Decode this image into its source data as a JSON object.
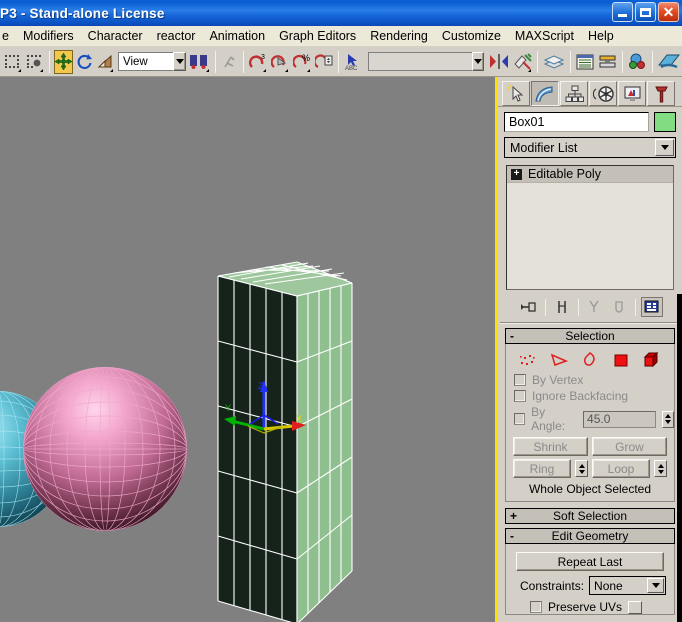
{
  "window": {
    "title": "P3  - Stand-alone License",
    "buttons": {
      "minimize": "_",
      "maximize": "□",
      "close": "✕"
    }
  },
  "menu": {
    "items": [
      "e",
      "Modifiers",
      "Character",
      "reactor",
      "Animation",
      "Graph Editors",
      "Rendering",
      "Customize",
      "MAXScript",
      "Help"
    ]
  },
  "toolbar": {
    "select_region_icon": "select-region-icon",
    "select_object_icon": "select-object-icon",
    "move_icon": "select-and-move-icon",
    "rotate_icon": "select-and-rotate-icon",
    "scale_icon": "select-and-scale-icon",
    "reference_coordinate_value": "View",
    "align_pivot_icon": "use-center-flyout-icon",
    "select_by_name_icon": "select-by-name-icon",
    "named_selection_value": "",
    "mirror_icon": "mirror-icon",
    "align_icon": "align-icon",
    "layers_icon": "layer-manager-icon",
    "curve_editor_icon": "curve-editor-icon",
    "schematic_icon": "schematic-view-icon",
    "material_icon": "material-editor-icon",
    "render_icon": "render-scene-icon",
    "snap3_icon": "snaps-toggle-icon",
    "angle_snap_icon": "angle-snap-icon",
    "percent_snap_icon": "percent-snap-icon",
    "spinner_snap_icon": "spinner-snap-icon",
    "keyframe_icon": "set-key-icon"
  },
  "command_panel": {
    "tabs": [
      {
        "name": "create",
        "icon": "create-arrow-icon",
        "active": false
      },
      {
        "name": "modify",
        "icon": "modify-curve-icon",
        "active": true
      },
      {
        "name": "hierarchy",
        "icon": "hierarchy-icon",
        "active": false
      },
      {
        "name": "motion",
        "icon": "motion-wheel-icon",
        "active": false
      },
      {
        "name": "display",
        "icon": "display-monitor-icon",
        "active": false
      },
      {
        "name": "utilities",
        "icon": "utilities-hammer-icon",
        "active": false
      }
    ],
    "object_name": "Box01",
    "object_color": "#82dd82",
    "modifier_list_label": "Modifier List",
    "stack": [
      {
        "label": "Editable Poly",
        "expander": "+"
      }
    ],
    "stack_buttons": [
      {
        "name": "pin-stack-icon"
      },
      {
        "name": "show-end-result-icon"
      },
      {
        "name": "make-unique-icon"
      },
      {
        "name": "remove-modifier-icon"
      },
      {
        "name": "configure-modifier-sets-icon"
      }
    ],
    "rollouts": {
      "selection": {
        "title": "Selection",
        "expander": "-",
        "sub_objects": [
          {
            "name": "vertex-icon",
            "label": "Vertex"
          },
          {
            "name": "edge-icon",
            "label": "Edge"
          },
          {
            "name": "border-icon",
            "label": "Border"
          },
          {
            "name": "polygon-icon",
            "label": "Polygon"
          },
          {
            "name": "element-icon",
            "label": "Element"
          }
        ],
        "by_vertex_label": "By Vertex",
        "by_vertex_checked": false,
        "ignore_backfacing_label": "Ignore Backfacing",
        "ignore_backfacing_checked": false,
        "by_angle_label": "By Angle:",
        "by_angle_checked": false,
        "by_angle_value": "45.0",
        "shrink_label": "Shrink",
        "grow_label": "Grow",
        "ring_label": "Ring",
        "loop_label": "Loop",
        "status": "Whole Object Selected"
      },
      "soft_selection": {
        "title": "Soft Selection",
        "expander": "+"
      },
      "edit_geometry": {
        "title": "Edit Geometry",
        "expander": "-",
        "repeat_last_label": "Repeat Last",
        "constraints_label": "Constraints:",
        "constraints_value": "None",
        "preserve_uvs_label": "Preserve UVs"
      }
    }
  },
  "viewport": {
    "background_color": "#808080",
    "active_border_color": "#ffe000",
    "objects": [
      {
        "name": "box-object",
        "label": "Box01",
        "shade_color": "#8fbf8f",
        "wire_color": "#ffffff"
      },
      {
        "name": "sphere-pink-object",
        "shade_color": "#c86a9a",
        "wire_color": "#f0a8cc"
      },
      {
        "name": "sphere-cyan-object",
        "shade_color": "#4fb0c0",
        "wire_color": "#9fe8f4"
      }
    ],
    "gizmo": {
      "name": "transform-gizmo",
      "axes": [
        {
          "label": "Z",
          "color": "#2030ff"
        },
        {
          "label": "Y",
          "color": "#00b000"
        },
        {
          "label": "X",
          "color": "#d8d800"
        }
      ]
    }
  }
}
